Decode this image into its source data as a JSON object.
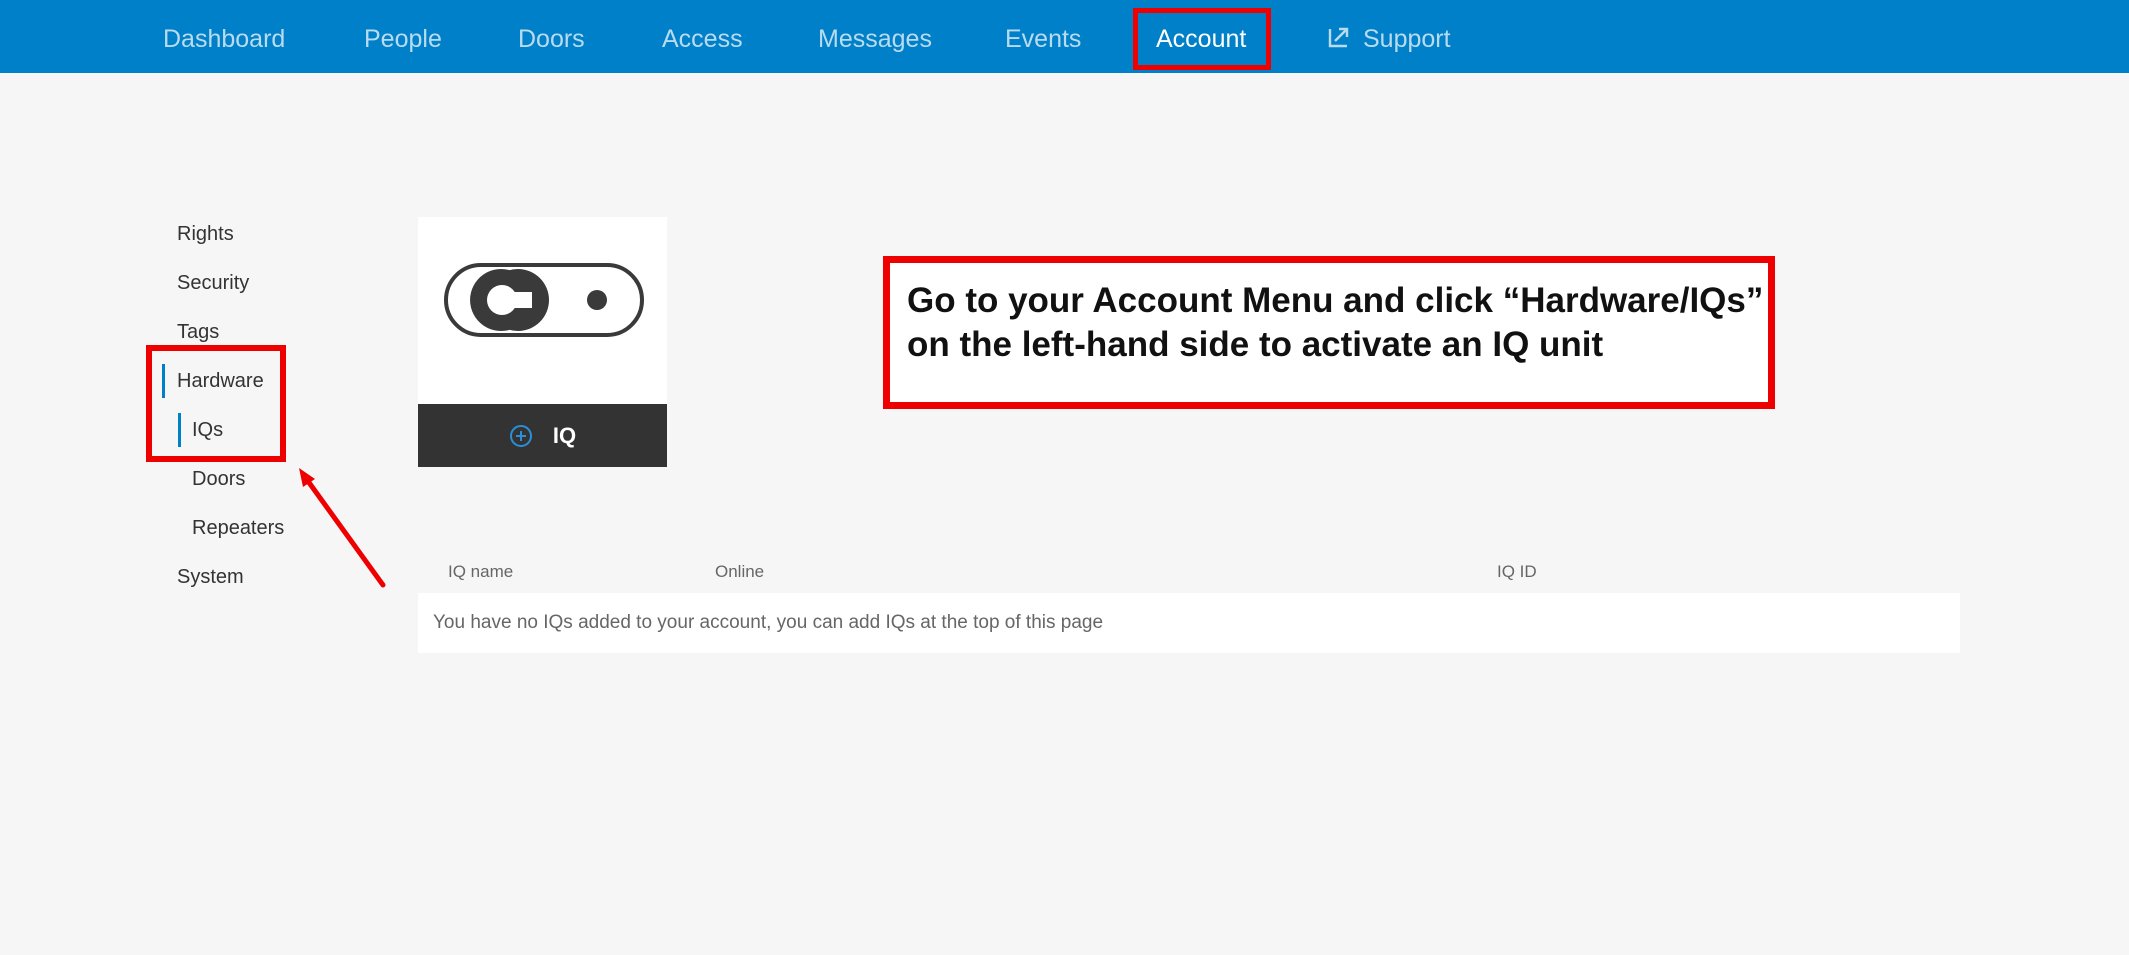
{
  "nav": {
    "items": [
      "Dashboard",
      "People",
      "Doors",
      "Access",
      "Messages",
      "Events",
      "Account",
      "Support"
    ]
  },
  "sidebar": {
    "items": [
      "Rights",
      "Security",
      "Tags",
      "Hardware",
      "IQs",
      "Doors",
      "Repeaters",
      "System"
    ]
  },
  "iq_card": {
    "button_label": "IQ",
    "logo_icon": "iq-device-icon",
    "add_icon": "plus-circle-icon"
  },
  "callout": {
    "line1": "Go to your Account Menu and click “Hardware/IQs”",
    "line2": "on the left-hand side to activate an IQ unit"
  },
  "table": {
    "headers": [
      "IQ name",
      "Online",
      "IQ ID"
    ],
    "empty_message": "You have no IQs added to your account, you can add IQs at the top of this page"
  },
  "colors": {
    "nav_bg": "#0080c8",
    "highlight": "#ee0000",
    "accent": "#0080c8"
  }
}
